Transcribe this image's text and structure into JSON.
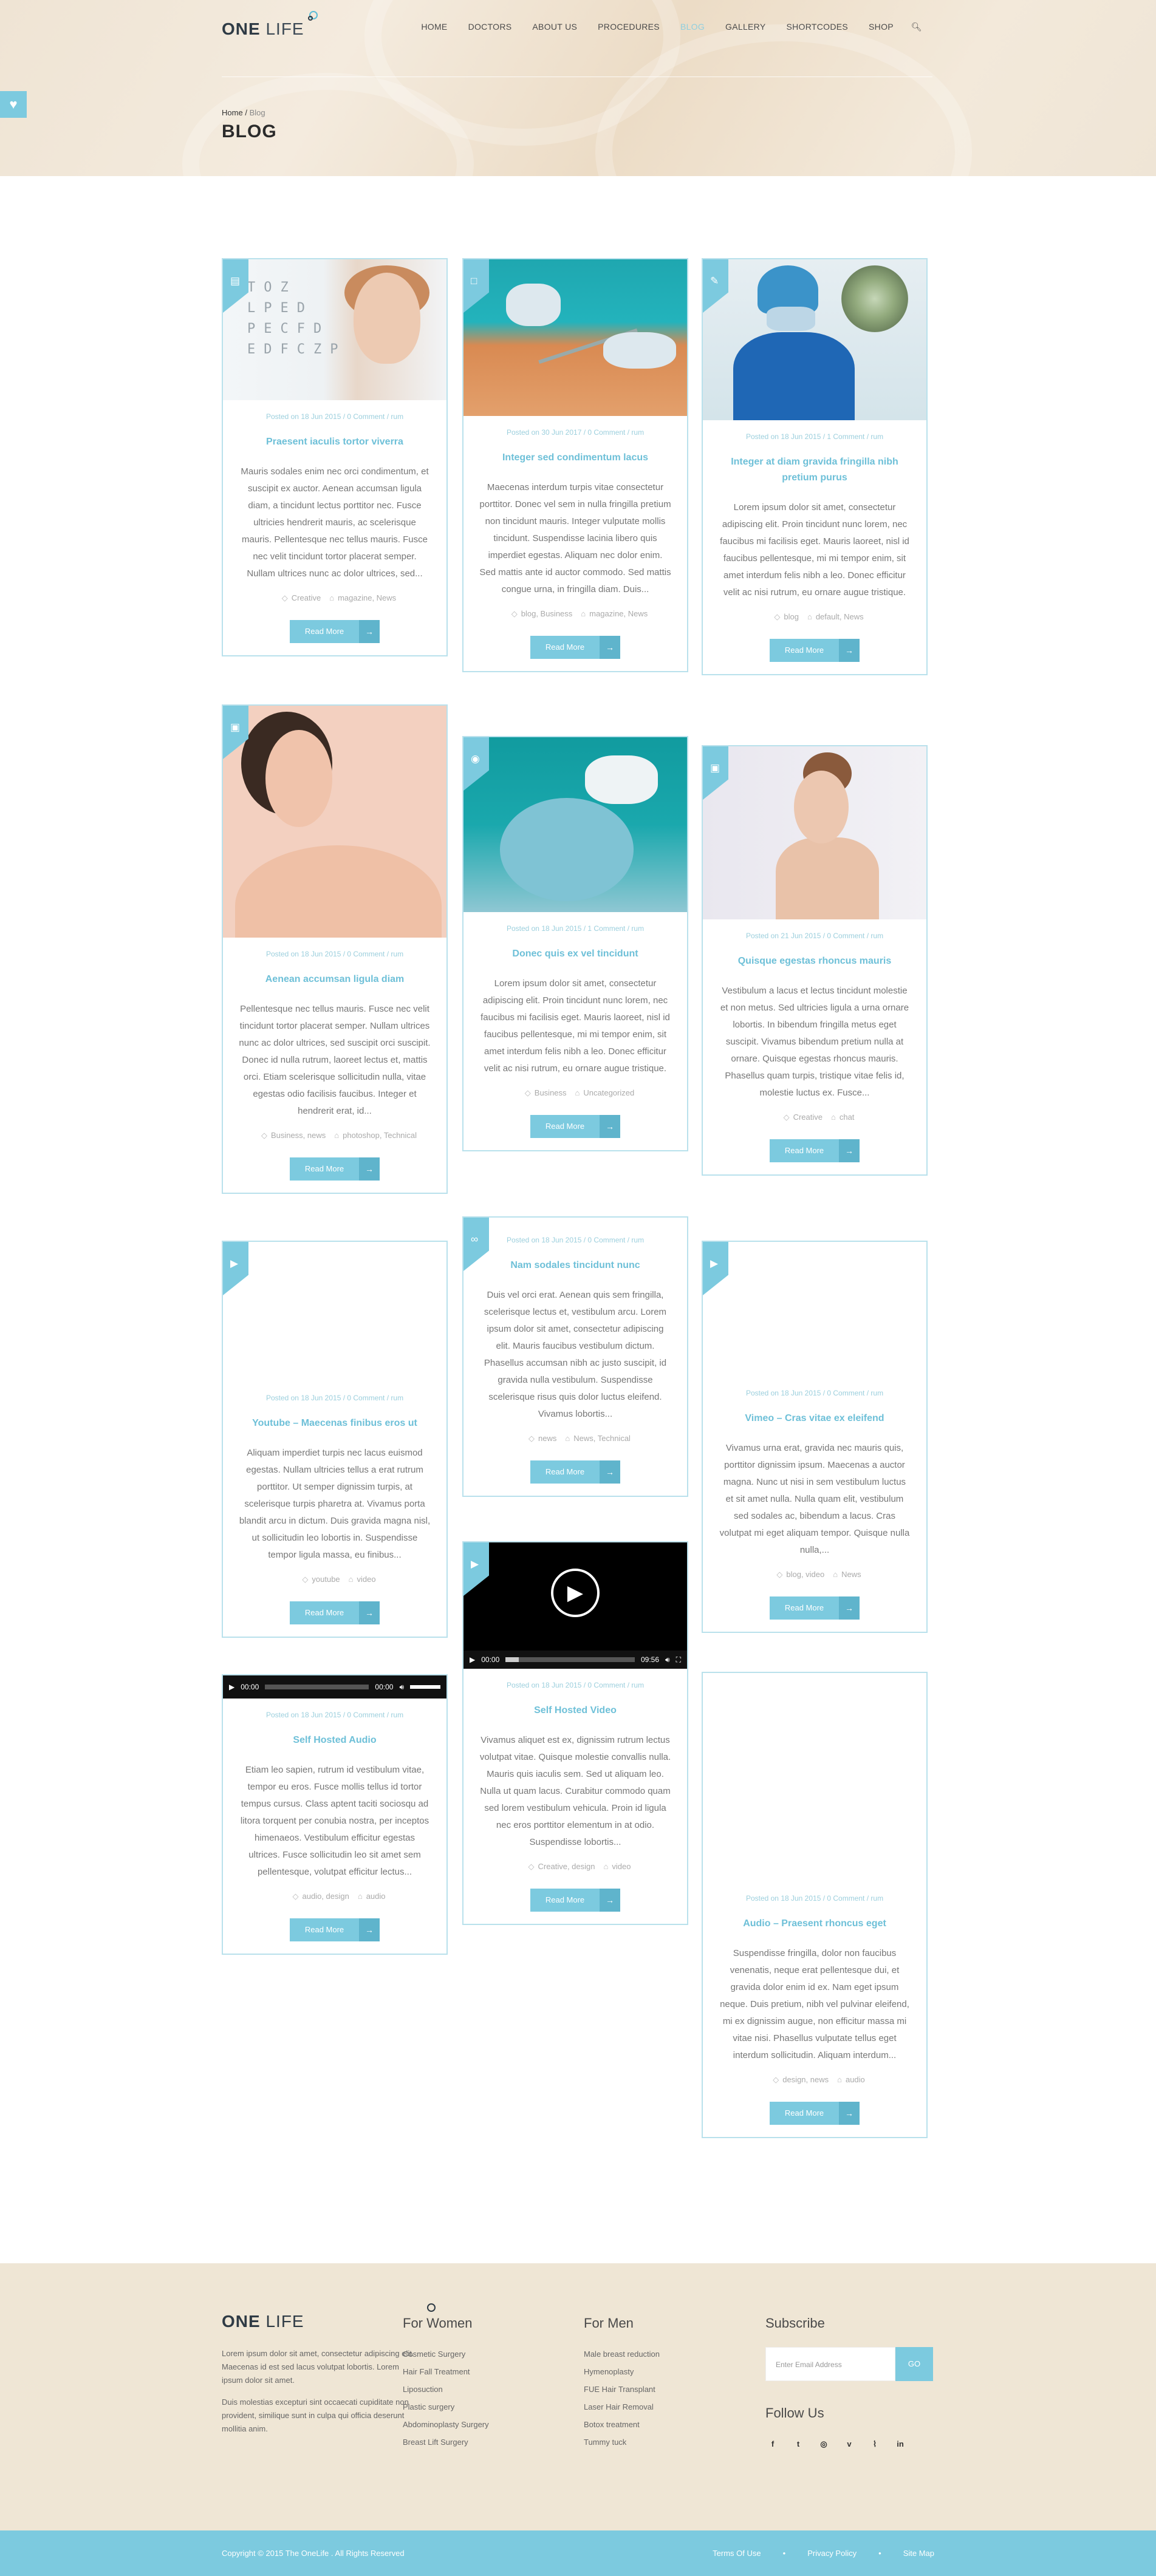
{
  "brand": {
    "name_bold": "ONE",
    "name_light": "LIFE"
  },
  "nav": [
    "HOME",
    "DOCTORS",
    "ABOUT US",
    "PROCEDURES",
    "BLOG",
    "GALLERY",
    "SHORTCODES",
    "SHOP"
  ],
  "nav_active": "BLOG",
  "breadcrumb": {
    "home": "Home",
    "separator": "/",
    "current": "Blog"
  },
  "page_title": "BLOG",
  "accent_color": "#7ccadf",
  "read_more": "Read More",
  "posts": [
    {
      "meta": "Posted on 18 Jun 2015 / 0 Comment / rum",
      "title": "Praesent iaculis tortor viverra",
      "excerpt": "Mauris sodales enim nec orci condimentum, et suscipit ex auctor. Aenean accumsan ligula diam, a tincidunt lectus porttitor nec. Fusce ultricies hendrerit mauris, ac scelerisque mauris. Pellentesque nec tellus mauris. Fusce nec velit tincidunt tortor placerat semper. Nullam ultrices nunc ac dolor ultrices, sed...",
      "tags1": "Creative",
      "tags2": "magazine, News",
      "icon": "chat-icon"
    },
    {
      "meta": "Posted on 30 Jun 2017 / 0 Comment / rum",
      "title": "Integer sed condimentum lacus",
      "excerpt": "Maecenas interdum turpis vitae consectetur porttitor. Donec vel sem in nulla fringilla pretium non tincidunt mauris. Integer vulputate mollis tincidunt. Suspendisse lacinia libero quis imperdiet egestas. Aliquam nec dolor enim. Sed mattis ante id auctor commodo. Sed mattis congue urna, in fringilla diam. Duis...",
      "tags1": "blog, Business",
      "tags2": "magazine, News",
      "icon": "document-icon"
    },
    {
      "meta": "Posted on 18 Jun 2015 / 1 Comment / rum",
      "title": "Integer at diam gravida fringilla nibh pretium purus",
      "excerpt": "Lorem ipsum dolor sit amet, consectetur adipiscing elit. Proin tincidunt nunc lorem, nec faucibus mi facilisis eget. Mauris laoreet, nisl id faucibus pellentesque, mi mi tempor enim, sit amet interdum felis nibh a leo. Donec efficitur velit ac nisi rutrum, eu ornare augue tristique.",
      "tags1": "blog",
      "tags2": "default, News",
      "icon": "edit-icon"
    },
    {
      "meta": "Posted on 18 Jun 2015 / 0 Comment / rum",
      "title": "Aenean accumsan ligula diam",
      "excerpt": "Pellentesque nec tellus mauris. Fusce nec velit tincidunt tortor placerat semper. Nullam ultrices nunc ac dolor ultrices, sed suscipit orci suscipit. Donec id nulla rutrum, laoreet lectus et, mattis orci. Etiam scelerisque sollicitudin nulla, vitae egestas odio facilisis faucibus. Integer et hendrerit erat, id...",
      "tags1": "Business, news",
      "tags2": "photoshop, Technical",
      "icon": "image-icon"
    },
    {
      "meta": "Posted on 18 Jun 2015 / 1 Comment / rum",
      "title": "Donec quis ex vel tincidunt",
      "excerpt": "Lorem ipsum dolor sit amet, consectetur adipiscing elit. Proin tincidunt nunc lorem, nec faucibus mi facilisis eget. Mauris laoreet, nisl id faucibus pellentesque, mi mi tempor enim, sit amet interdum felis nibh a leo. Donec efficitur velit ac nisi rutrum, eu ornare augue tristique.",
      "tags1": "Business",
      "tags2": "Uncategorized",
      "icon": "camera-icon"
    },
    {
      "meta": "Posted on 21 Jun 2015 / 0 Comment / rum",
      "title": "Quisque egestas rhoncus mauris",
      "excerpt": "Vestibulum a lacus et lectus tincidunt molestie et non metus. Sed ultricies ligula a urna ornare lobortis. In bibendum fringilla metus eget suscipit. Vivamus bibendum pretium nulla at ornare. Quisque egestas rhoncus mauris. Phasellus quam turpis, tristique vitae felis id, molestie luctus ex. Fusce...",
      "tags1": "Creative",
      "tags2": "chat",
      "icon": "image-icon"
    },
    {
      "meta": "Posted on 18 Jun 2015 / 0 Comment / rum",
      "title": "Youtube – Maecenas finibus eros ut",
      "excerpt": "Aliquam imperdiet turpis nec lacus euismod egestas. Nullam ultricies tellus a erat rutrum porttitor. Ut semper dignissim turpis, at scelerisque turpis pharetra at. Vivamus porta blandit arcu in dictum. Duis gravida magna nisl, ut sollicitudin leo lobortis in. Suspendisse tempor ligula massa, eu finibus...",
      "tags1": "youtube",
      "tags2": "video",
      "icon": "video-icon"
    },
    {
      "meta": "Posted on 18 Jun 2015 / 0 Comment / rum",
      "title": "Nam sodales tincidunt nunc",
      "excerpt": "Duis vel orci erat. Aenean quis sem fringilla, scelerisque lectus et, vestibulum arcu. Lorem ipsum dolor sit amet, consectetur adipiscing elit. Mauris faucibus vestibulum dictum. Phasellus accumsan nibh ac justo suscipit, id gravida nulla vestibulum. Suspendisse scelerisque risus quis dolor luctus eleifend. Vivamus lobortis...",
      "tags1": "news",
      "tags2": "News, Technical",
      "icon": "link-icon"
    },
    {
      "meta": "Posted on 18 Jun 2015 / 0 Comment / rum",
      "title": "Vimeo – Cras vitae ex eleifend",
      "excerpt": "Vivamus urna erat, gravida nec mauris quis, porttitor dignissim ipsum. Maecenas a auctor magna. Nunc ut nisi in sem vestibulum luctus et sit amet nulla. Nulla quam elit, vestibulum sed sodales ac, bibendum a lacus. Cras volutpat mi eget aliquam tempor. Quisque nulla nulla,...",
      "tags1": "blog, video",
      "tags2": "News",
      "icon": "video-icon"
    },
    {
      "meta": "Posted on 18 Jun 2015 / 0 Comment / rum",
      "title": "Self Hosted Video",
      "excerpt": "Vivamus aliquet est ex, dignissim rutrum lectus volutpat vitae. Quisque molestie convallis nulla. Mauris quis iaculis sem. Sed ut aliquam leo. Nulla ut quam lacus. Curabitur commodo quam sed lorem vestibulum vehicula. Proin id ligula nec eros porttitor elementum in at odio. Suspendisse lobortis...",
      "tags1": "Creative, design",
      "tags2": "video",
      "icon": "video-icon",
      "time_start": "00:00",
      "time_end": "09:56"
    },
    {
      "meta": "Posted on 18 Jun 2015 / 0 Comment / rum",
      "title": "Self Hosted Audio",
      "excerpt": "Etiam leo sapien, rutrum id vestibulum vitae, tempor eu eros. Fusce mollis tellus id tortor tempus cursus. Class aptent taciti sociosqu ad litora torquent per conubia nostra, per inceptos himenaeos. Vestibulum efficitur egestas ultrices. Fusce sollicitudin leo sit amet sem pellentesque, volutpat efficitur lectus...",
      "tags1": "audio, design",
      "tags2": "audio",
      "time_start": "00:00",
      "time_end": "00:00"
    },
    {
      "meta": "Posted on 18 Jun 2015 / 0 Comment / rum",
      "title": "Audio – Praesent rhoncus eget",
      "excerpt": "Suspendisse fringilla, dolor non faucibus venenatis, neque erat pellentesque dui, et gravida dolor enim id ex. Nam eget ipsum neque. Duis pretium, nibh vel pulvinar eleifend, mi ex dignissim augue, non efficitur massa mi vitae nisi. Phasellus vulputate tellus eget interdum sollicitudin. Aliquam interdum...",
      "tags1": "design, news",
      "tags2": "audio"
    }
  ],
  "footer": {
    "about": "Lorem ipsum dolor sit amet, consectetur adipiscing elit. Maecenas id est sed lacus volutpat lobortis. Lorem ipsum dolor sit amet.",
    "about2": "Duis molestias excepturi sint occaecati cupiditate non provident, similique sunt in culpa qui officia deserunt mollitia anim.",
    "women_title": "For Women",
    "women": [
      "Cosmetic Surgery",
      "Hair Fall Treatment",
      "Liposuction",
      "Plastic surgery",
      "Abdominoplasty Surgery",
      "Breast Lift Surgery"
    ],
    "men_title": "For Men",
    "men": [
      "Male breast reduction",
      "Hymenoplasty",
      "FUE Hair Transplant",
      "Laser Hair Removal",
      "Botox treatment",
      "Tummy tuck"
    ],
    "subscribe_title": "Subscribe",
    "email_placeholder": "Enter Email Address",
    "go": "GO",
    "follow_title": "Follow Us",
    "social": [
      "f",
      "t",
      "◎",
      "v",
      "⌇",
      "in"
    ]
  },
  "copyright": "Copyright © 2015 The OneLife . All Rights Reserved",
  "bottom_links": [
    "Terms Of Use",
    "Privacy Policy",
    "Site Map"
  ]
}
